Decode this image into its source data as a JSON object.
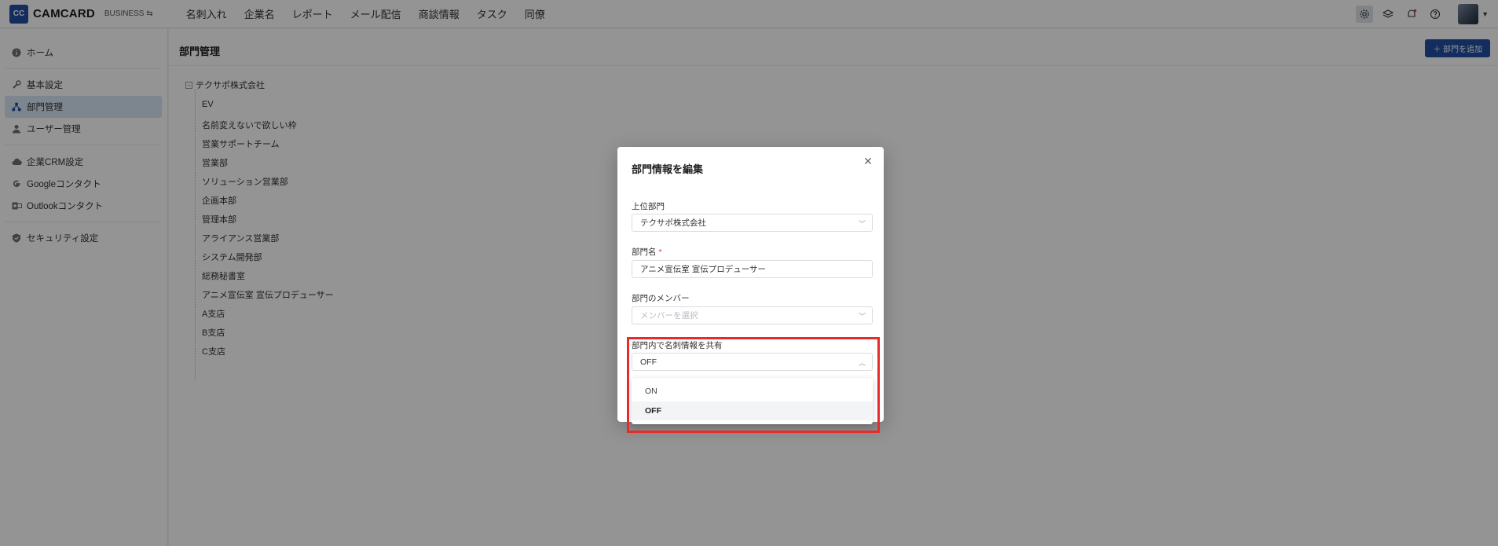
{
  "app": {
    "logo_mark": "CC",
    "name": "CAMCARD",
    "edition": "BUSINESS ⇆"
  },
  "topnav": [
    "名刺入れ",
    "企業名",
    "レポート",
    "メール配信",
    "商談情報",
    "タスク",
    "同僚"
  ],
  "sidebar": {
    "items": [
      {
        "label": "ホーム",
        "icon": "info-icon"
      },
      {
        "label": "基本設定",
        "icon": "wrench-icon"
      },
      {
        "label": "部門管理",
        "icon": "org-icon",
        "selected": true
      },
      {
        "label": "ユーザー管理",
        "icon": "user-icon"
      },
      {
        "label": "企業CRM設定",
        "icon": "cloud-icon"
      },
      {
        "label": "Googleコンタクト",
        "icon": "google-icon"
      },
      {
        "label": "Outlookコンタクト",
        "icon": "outlook-icon"
      },
      {
        "label": "セキュリティ設定",
        "icon": "shield-icon"
      }
    ]
  },
  "main": {
    "title": "部門管理",
    "add_button": "＋ 部門を追加",
    "tree": {
      "toggle": "−",
      "root": "テクサポ株式会社",
      "children": [
        "EV",
        "名前変えないで欲しい枠",
        "営業サポートチーム",
        "営業部",
        "ソリューション営業部",
        "企画本部",
        "管理本部",
        "アライアンス営業部",
        "システム開発部",
        "総務秘書室",
        "アニメ宣伝室 宣伝プロデューサー",
        "A支店",
        "B支店",
        "C支店"
      ]
    }
  },
  "modal": {
    "title": "部門情報を編集",
    "close": "✕",
    "parent_label": "上位部門",
    "parent_value": "テクサポ株式会社",
    "name_label": "部門名",
    "name_required": "*",
    "name_value": "アニメ宣伝室 宣伝プロデューサー",
    "members_label": "部門のメンバー",
    "members_placeholder": "メンバーを選択",
    "share_label": "部門内で名刺情報を共有",
    "share_value": "OFF",
    "share_options": [
      "ON",
      "OFF"
    ]
  },
  "colors": {
    "brand": "#1f4fa3",
    "highlight": "#e52b2b",
    "selected_nav": "#d8e6f7"
  }
}
